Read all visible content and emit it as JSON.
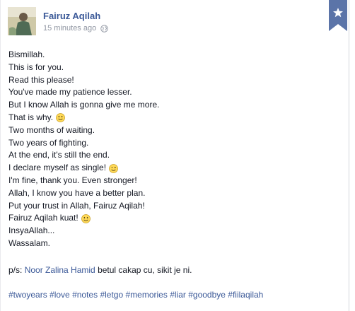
{
  "post": {
    "author": "Fairuz Aqilah",
    "timestamp": "15 minutes ago",
    "privacy_icon": "globe-icon",
    "ribbon_icon": "star-icon",
    "lines": [
      {
        "text": "Bismillah.",
        "emoticon": null
      },
      {
        "text": "This is for you.",
        "emoticon": null
      },
      {
        "text": "Read this please!",
        "emoticon": null
      },
      {
        "text": "You've made my patience lesser.",
        "emoticon": null
      },
      {
        "text": "But I know Allah is gonna give me more.",
        "emoticon": null
      },
      {
        "text": "That is why.",
        "emoticon": "smile"
      },
      {
        "text": "Two months of waiting.",
        "emoticon": null
      },
      {
        "text": "Two years of fighting.",
        "emoticon": null
      },
      {
        "text": "At the end, it's still the end.",
        "emoticon": null
      },
      {
        "text": "I declare myself as single!",
        "emoticon": "wink"
      },
      {
        "text": "I'm fine, thank you. Even stronger!",
        "emoticon": null
      },
      {
        "text": "Allah, I know you have a better plan.",
        "emoticon": null
      },
      {
        "text": "Put your trust in Allah, Fairuz Aqilah!",
        "emoticon": null
      },
      {
        "text": "Fairuz Aqilah kuat!",
        "emoticon": "smile"
      },
      {
        "text": "InsyaAllah...",
        "emoticon": null
      },
      {
        "text": "Wassalam.",
        "emoticon": null
      }
    ],
    "ps_prefix": "p/s: ",
    "ps_mention": "Noor Zalina Hamid",
    "ps_suffix": " betul cakap cu, sikit je ni.",
    "hashtags": [
      "#twoyears",
      "#love",
      "#notes",
      "#letgo",
      "#memories",
      "#liar",
      "#goodbye",
      "#fiilaqilah"
    ]
  },
  "colors": {
    "link": "#3b5998",
    "muted": "#9197a3",
    "ribbon": "#5b74a8"
  }
}
